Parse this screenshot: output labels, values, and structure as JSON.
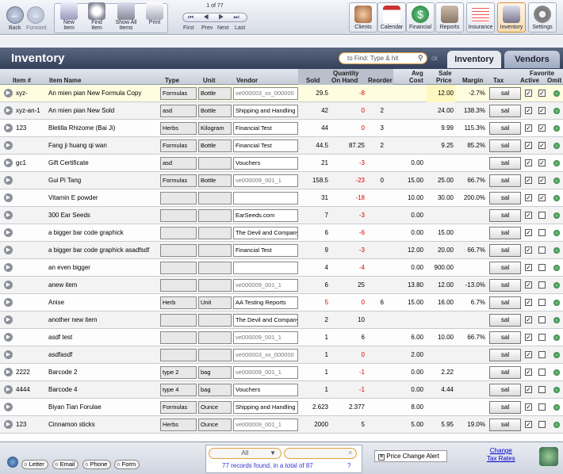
{
  "toolbar": {
    "back": "Back",
    "forward": "Forward",
    "new_item": "New\nItem",
    "find_item": "Find\nItem",
    "show_all": "Show All\nItems",
    "print": "Print",
    "pager": {
      "text": "1 of 77",
      "first": "First",
      "prev": "Prev",
      "next": "Next",
      "last": "Last"
    },
    "modules": [
      "Clients",
      "Calendar",
      "Financial",
      "Reports",
      "Insurance",
      "Inventory",
      "Settings"
    ]
  },
  "header": {
    "title": "Inventory",
    "search_placeholder": "to Find: Type & hit",
    "tabs": [
      "Inventory",
      "Vendors"
    ]
  },
  "columns": {
    "item_no": "Item #",
    "item_name": "Item Name",
    "type": "Type",
    "unit": "Unit",
    "vendor": "Vendor",
    "quantity": "Quantity",
    "sold": "Sold",
    "on_hand": "On Hand",
    "reorder": "Reorder",
    "avg_cost": "Avg\nCost",
    "sale_price": "Sale\nPrice",
    "margin": "Margin",
    "tax": "Tax",
    "favorite": "Favorite",
    "active": "Active",
    "omit": "Omit"
  },
  "rows": [
    {
      "no": "xyz-",
      "name": "An mien pian New Formula Copy",
      "type": "Formulas",
      "unit": "Bottle",
      "vendor": "ve000003_xx_000000",
      "sold": "29.5",
      "onhand": "-8",
      "reorder": "",
      "cost": "",
      "price": "12.00",
      "margin": "-2.7%",
      "active": true,
      "omit": true
    },
    {
      "no": "xyz-an-1",
      "name": "An mien pian New Sold",
      "type": "asd",
      "unit": "Bottle",
      "vendor": "Shipping and Handling",
      "sold": "42",
      "onhand": "0",
      "reorder": "2",
      "cost": "",
      "price": "24.00",
      "margin": "138.3%",
      "active": true,
      "omit": true
    },
    {
      "no": "123",
      "name": "Bletilla Rhizome  (Bai Ji)",
      "type": "Herbs",
      "unit": "Kilogram",
      "vendor": "Financial Test",
      "sold": "44",
      "onhand": "0",
      "reorder": "3",
      "cost": "",
      "price": "9.99",
      "margin": "115.3%",
      "active": true,
      "omit": true
    },
    {
      "no": "",
      "name": "Fang ji huang qi wan",
      "type": "Formulas",
      "unit": "Bottle",
      "vendor": "Financial Test",
      "sold": "44.5",
      "onhand": "87.25",
      "reorder": "2",
      "cost": "",
      "price": "9.25",
      "margin": "85.2%",
      "active": true,
      "omit": true
    },
    {
      "no": "gc1",
      "name": "Gift Certificate",
      "type": "asd",
      "unit": "",
      "vendor": "Vouchers",
      "sold": "21",
      "onhand": "-3",
      "reorder": "",
      "cost": "0.00",
      "price": "",
      "margin": "",
      "active": true,
      "omit": true
    },
    {
      "no": "",
      "name": "Gui Pi Tang",
      "type": "Formulas",
      "unit": "Bottle",
      "vendor": "ve000009_001_1",
      "sold": "158.5",
      "onhand": "-23",
      "reorder": "0",
      "cost": "15.00",
      "price": "25.00",
      "margin": "66.7%",
      "active": true,
      "omit": true
    },
    {
      "no": "",
      "name": "Vitamin E powder",
      "type": "",
      "unit": "",
      "vendor": "",
      "sold": "31",
      "onhand": "-18",
      "reorder": "",
      "cost": "10.00",
      "price": "30.00",
      "margin": "200.0%",
      "active": true,
      "omit": true
    },
    {
      "no": "",
      "name": "300 Ear Seeds",
      "type": "",
      "unit": "",
      "vendor": "EarSeeds.com",
      "sold": "7",
      "onhand": "-3",
      "reorder": "",
      "cost": "0.00",
      "price": "",
      "margin": "",
      "active": true,
      "omit": false
    },
    {
      "no": "",
      "name": "a bigger bar code graphick",
      "type": "",
      "unit": "",
      "vendor": "The Devil and Company",
      "sold": "6",
      "onhand": "-6",
      "reorder": "",
      "cost": "0.00",
      "price": "15.00",
      "margin": "",
      "active": true,
      "omit": false
    },
    {
      "no": "",
      "name": "a bigger bar code graphick asadfsdf",
      "type": "",
      "unit": "",
      "vendor": "Financial Test",
      "sold": "9",
      "onhand": "-3",
      "reorder": "",
      "cost": "12.00",
      "price": "20.00",
      "margin": "66.7%",
      "active": true,
      "omit": false
    },
    {
      "no": "",
      "name": "an even bigger",
      "type": "",
      "unit": "",
      "vendor": "",
      "sold": "4",
      "onhand": "-4",
      "reorder": "",
      "cost": "0.00",
      "price": "900.00",
      "margin": "",
      "active": true,
      "omit": false
    },
    {
      "no": "",
      "name": "anew item",
      "type": "",
      "unit": "",
      "vendor": "ve000009_001_1",
      "sold": "6",
      "onhand": "25",
      "reorder": "",
      "cost": "13.80",
      "price": "12.00",
      "margin": "-13.0%",
      "active": true,
      "omit": false
    },
    {
      "no": "",
      "name": "Anise",
      "type": "Herb",
      "unit": "Unit",
      "vendor": "AA Testing Reports",
      "sold": "5",
      "onhand": "0",
      "reorder": "6",
      "cost": "15.00",
      "price": "16.00",
      "margin": "6.7%",
      "active": true,
      "omit": false,
      "sold_red": true
    },
    {
      "no": "",
      "name": "another new item",
      "type": "",
      "unit": "",
      "vendor": "The Devil and Company",
      "sold": "2",
      "onhand": "10",
      "reorder": "",
      "cost": "",
      "price": "",
      "margin": "",
      "active": true,
      "omit": false
    },
    {
      "no": "",
      "name": "asdf test",
      "type": "",
      "unit": "",
      "vendor": "ve000009_001_1",
      "sold": "1",
      "onhand": "6",
      "reorder": "",
      "cost": "6.00",
      "price": "10.00",
      "margin": "66.7%",
      "active": true,
      "omit": false
    },
    {
      "no": "",
      "name": "asdfasdf",
      "type": "",
      "unit": "",
      "vendor": "ve000003_xx_000000",
      "sold": "1",
      "onhand": "0",
      "reorder": "",
      "cost": "2.00",
      "price": "",
      "margin": "",
      "active": true,
      "omit": false
    },
    {
      "no": "2222",
      "name": "Barcode 2",
      "type": "type 2",
      "unit": "bag",
      "vendor": "ve000009_001_1",
      "sold": "1",
      "onhand": "-1",
      "reorder": "",
      "cost": "0.00",
      "price": "2.22",
      "margin": "",
      "active": true,
      "omit": false
    },
    {
      "no": "4444",
      "name": "Barcode 4",
      "type": "type 4",
      "unit": "bag",
      "vendor": "Vouchers",
      "sold": "1",
      "onhand": "-1",
      "reorder": "",
      "cost": "0.00",
      "price": "4.44",
      "margin": "",
      "active": true,
      "omit": false
    },
    {
      "no": "",
      "name": "Biyan Tian  Forulae",
      "type": "Formulas",
      "unit": "Ounce",
      "vendor": "Shipping and Handling",
      "sold": "2.623",
      "onhand": "2.377",
      "reorder": "",
      "cost": "8.00",
      "price": "",
      "margin": "",
      "active": true,
      "omit": false
    },
    {
      "no": "123",
      "name": "Cinnamon sticks",
      "type": "Herbs",
      "unit": "Ounce",
      "vendor": "ve000009_001_1",
      "sold": "2000",
      "onhand": "5",
      "reorder": "",
      "cost": "5.00",
      "price": "5.95",
      "margin": "19.0%",
      "active": true,
      "omit": false
    }
  ],
  "tax_label": "sal",
  "footer": {
    "filter": "All",
    "records": "77 records found, in a total of 87",
    "price_alert": "Price Change Alert",
    "change_tax": "Change\nTax Rates",
    "buttons": [
      "Letter",
      "Email",
      "Phone",
      "Form"
    ]
  }
}
